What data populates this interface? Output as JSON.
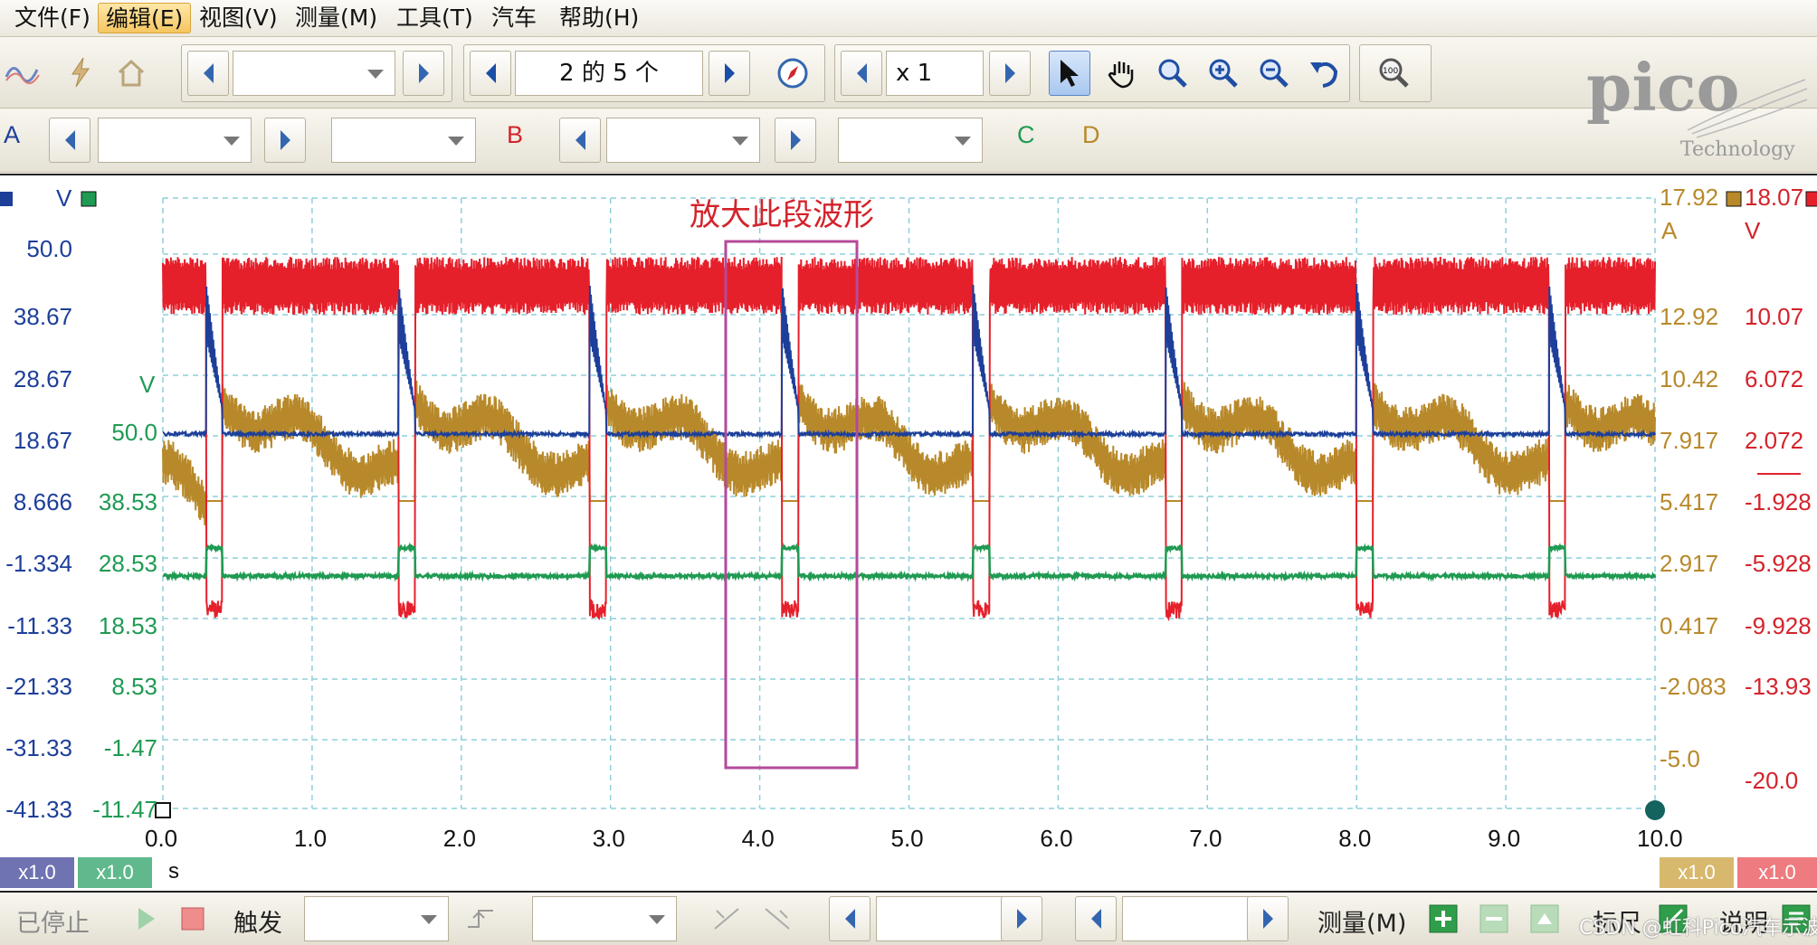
{
  "menu": [
    "文件(F)",
    "编辑(E)",
    "视图(V)",
    "测量(M)",
    "工具(T)",
    "汽车",
    "帮助(H)"
  ],
  "menu_active_index": 1,
  "toolbar": {
    "buffer_label": "2 的 5 个",
    "zoom_label": "x 1",
    "tools": [
      "pointer-tool-icon",
      "hand-tool-icon",
      "zoom-area-icon",
      "zoom-in-icon",
      "zoom-out-icon",
      "undo-zoom-icon",
      "zoom-100-icon"
    ]
  },
  "channels": {
    "a": "A",
    "b": "B",
    "c": "C",
    "d": "D"
  },
  "logo": {
    "brand": "pico",
    "sub": "Technology"
  },
  "scope": {
    "annotation": "放大此段波形",
    "axis_blue_unit": "V",
    "axis_green_unit": "V",
    "axis_gold_unit": "A",
    "axis_red_unit": "V",
    "axis_blue": [
      "50.0",
      "38.67",
      "28.67",
      "18.67",
      "8.666",
      "-1.334",
      "-11.33",
      "-21.33",
      "-31.33",
      "-41.33"
    ],
    "axis_green": [
      "50.0",
      "38.53",
      "28.53",
      "18.53",
      "8.53",
      "-1.47",
      "-11.47"
    ],
    "axis_gold": [
      "17.92",
      "12.92",
      "10.42",
      "7.917",
      "5.417",
      "2.917",
      "0.417",
      "-2.083",
      "-5.0"
    ],
    "axis_red": [
      "18.07",
      "10.07",
      "6.072",
      "2.072",
      "-1.928",
      "-5.928",
      "-9.928",
      "-13.93",
      "-20.0"
    ],
    "x_ticks": [
      "0.0",
      "1.0",
      "2.0",
      "3.0",
      "4.0",
      "5.0",
      "6.0",
      "7.0",
      "8.0",
      "9.0",
      "10.0"
    ],
    "x_unit": "s",
    "colors": {
      "blue": "#1d3f9a",
      "green": "#1f9a52",
      "gold": "#b8892a",
      "red": "#e5202b",
      "grid": "#8ecfdc",
      "annotation_box": "#b44a9a"
    }
  },
  "scale_pills": [
    "x1.0",
    "x1.0",
    "x1.0",
    "x1.0"
  ],
  "status": {
    "state": "已停止",
    "trigger_label": "触发",
    "measure_label": "测量(M)",
    "ruler_label": "标尺",
    "notes_label": "说明"
  },
  "watermark": "CSDN @虹科Pico汽车示波器"
}
